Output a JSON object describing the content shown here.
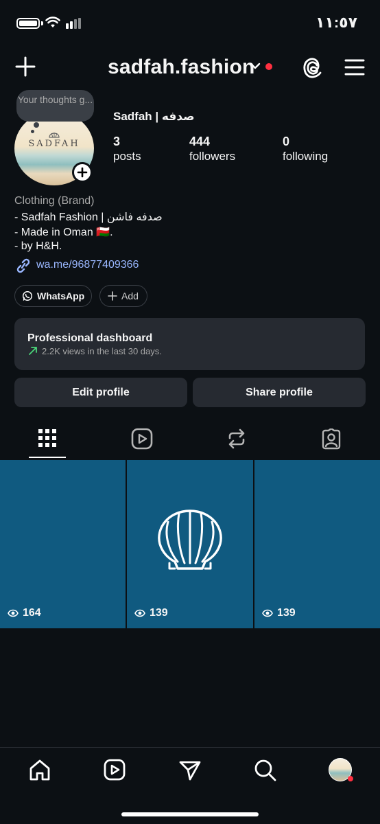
{
  "status": {
    "time": "١١:٥٧"
  },
  "header": {
    "username": "sadfah.fashion"
  },
  "profile": {
    "note_bubble": "Your thoughts g...",
    "avatar_logo": "SADFAH",
    "display_name": "Sadfah | صدفه",
    "stats": [
      {
        "value": "3",
        "label": "posts"
      },
      {
        "value": "444",
        "label": "followers"
      },
      {
        "value": "0",
        "label": "following"
      }
    ],
    "category": "Clothing (Brand)",
    "bio_lines": [
      "- Sadfah Fashion | صدفه فاشن",
      "- Made in Oman 🇴🇲.",
      "- by H&H."
    ],
    "link": "wa.me/96877409366",
    "pills": {
      "whatsapp": "WhatsApp",
      "add": "Add"
    }
  },
  "dashboard": {
    "title": "Professional dashboard",
    "subtitle": "2.2K views in the last 30 days."
  },
  "buttons": {
    "edit": "Edit profile",
    "share": "Share profile"
  },
  "tabs": [
    "grid-icon",
    "reels-icon",
    "reposts-icon",
    "tagged-icon"
  ],
  "posts": [
    {
      "views": "164"
    },
    {
      "views": "139"
    },
    {
      "views": "139"
    }
  ],
  "colors": {
    "background": "#0c1014",
    "tile": "#105a80",
    "accent_red": "#ff3040",
    "link": "#9ab7ff",
    "trend_green": "#4ad67a"
  },
  "bottom_nav": [
    "home-icon",
    "reels-icon",
    "direct-icon",
    "search-icon",
    "profile-avatar"
  ]
}
